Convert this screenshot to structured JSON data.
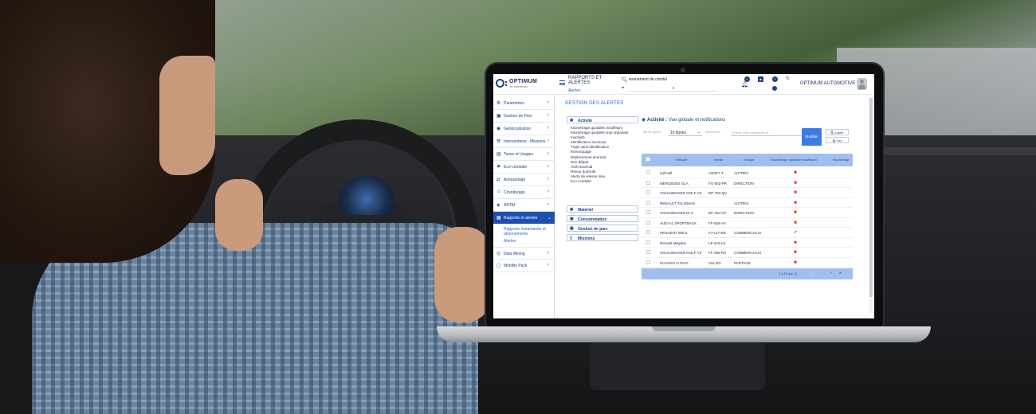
{
  "colors": {
    "brand": "#1d3f8f",
    "accent": "#3b7be6",
    "table_header": "#9fc0ef",
    "error": "#e21d1d",
    "ok": "#2f8a3a"
  },
  "header": {
    "logo_text": "OPTIMUM",
    "logo_sub": "BY SHIFTBONS",
    "page_title": "RAPPORTS ET ALERTES",
    "breadcrumb": "Alertes",
    "search_value": "evenement de condui",
    "company": "OPTIMUM AUTOMOTIVE",
    "close_glyph": "x"
  },
  "sidebar": {
    "items": [
      {
        "label": "Paramètres",
        "icon": "gear-icon"
      },
      {
        "label": "Gestion de Parc",
        "icon": "car-icon"
      },
      {
        "label": "Géolocalisation",
        "icon": "location-icon"
      },
      {
        "label": "Interventions - Missions",
        "icon": "wrench-icon"
      },
      {
        "label": "Taxes et Usages",
        "icon": "money-icon"
      },
      {
        "label": "Eco-conduite",
        "icon": "leaf-icon"
      },
      {
        "label": "Autopartage",
        "icon": "share-icon"
      },
      {
        "label": "Covoiturage",
        "icon": "people-icon"
      },
      {
        "label": "ANTAI",
        "icon": "shield-icon"
      },
      {
        "label": "Rapports et alertes",
        "icon": "report-icon"
      },
      {
        "label": "Data Mining",
        "icon": "database-icon"
      },
      {
        "label": "Mobility Pack",
        "icon": "box-icon"
      }
    ],
    "sub_items": [
      "Rapports instantanés et abonnements",
      "Alertes"
    ]
  },
  "main": {
    "title": "GESTION DES ALERTES",
    "accordion": {
      "activite": "Activité",
      "materiel": "Matériel",
      "consommation": "Consommation",
      "gestion_parc": "Gestion de parc",
      "missions": "Missions"
    },
    "activity_list": [
      "Kilométrage quotidien insuffisant",
      "Kilométrage quotidien trop important",
      "Inactivité",
      "Identification inconnue",
      "Trajet sans identification",
      "Remorquage",
      "Déplacement anormal",
      "Non-départ",
      "Arrêt anormal",
      "Retour domicile",
      "Alerte de vitesse max.",
      "Eco conduite"
    ]
  },
  "panel": {
    "title_bold": "Activité :",
    "title_rest": "Vue globale et notifications",
    "nb_lignes_label": "Nb de lignes",
    "nb_lignes_value": "10 lignes",
    "recherche_label": "Recherche",
    "recherche_placeholder": "Entrez votre recherche ici",
    "modifier_label": "Modifier",
    "copier_label": "Copier",
    "csv_label": "Csv",
    "columns": [
      "Véhicule",
      "Immat.",
      "Groupe",
      "Kilométrage quotidien insuffisant",
      "Kilométrage"
    ],
    "rows": [
      {
        "vehicule": "null null",
        "immat": "ASSET T...",
        "groupe": "AUTRES",
        "status": "✖"
      },
      {
        "vehicule": "MERCEDES GLA",
        "immat": "FG-602-PR",
        "groupe": "DIRECTION",
        "status": "✖"
      },
      {
        "vehicule": "VOLKSWAGEN GOLF VII",
        "immat": "DP-763-QV",
        "groupe": "",
        "status": "✖"
      },
      {
        "vehicule": "RENAULT TALISMAN",
        "immat": "",
        "groupe": "AUTRES",
        "status": "✖"
      },
      {
        "vehicule": "VOLKSWAGEN ID 3",
        "immat": "DF-404-CF",
        "groupe": "DIRECTION",
        "status": "✖"
      },
      {
        "vehicule": "AUDI A1 SPORTBACK",
        "immat": "FF-926-AX",
        "groupe": "",
        "status": "✖"
      },
      {
        "vehicule": "PEUGEOT 508 II",
        "immat": "FJ-147-EB",
        "groupe": "COMMERCIAUX",
        "status": "✔"
      },
      {
        "vehicule": "Renault Mégane",
        "immat": "LE-415-LE",
        "groupe": "",
        "status": "✖"
      },
      {
        "vehicule": "VOLKSWAGEN GOLF VII",
        "immat": "FF-395-RX",
        "groupe": "COMMERCIAUX",
        "status": "✖"
      },
      {
        "vehicule": "PIAGGIO O PIAG",
        "immat": "VULOG",
        "groupe": "PARTAGE",
        "status": "✖"
      }
    ],
    "pagination": "1 à 10 sur 11"
  }
}
